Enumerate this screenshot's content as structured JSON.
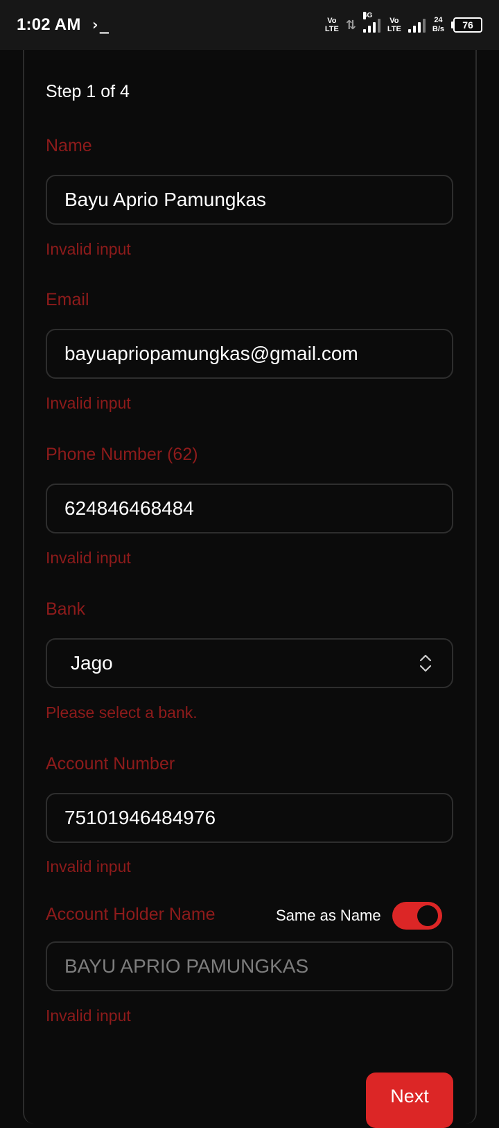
{
  "status_bar": {
    "time": "1:02 AM",
    "terminal_glyph": "›_",
    "volte1_top": "Vo",
    "volte1_bottom": "LTE",
    "network_type": "4G",
    "volte2_top": "Vo",
    "volte2_bottom": "LTE",
    "speed_value": "24",
    "speed_unit": "B/s",
    "battery_level": "76"
  },
  "form": {
    "step_text": "Step 1 of 4",
    "name": {
      "label": "Name",
      "value": "Bayu Aprio Pamungkas",
      "error": "Invalid input"
    },
    "email": {
      "label": "Email",
      "value": "bayuapriopamungkas@gmail.com",
      "error": "Invalid input"
    },
    "phone": {
      "label": "Phone Number (62)",
      "value": "624846468484",
      "error": "Invalid input"
    },
    "bank": {
      "label": "Bank",
      "selected": "Jago",
      "error": "Please select a bank."
    },
    "account_number": {
      "label": "Account Number",
      "value": "75101946484976",
      "error": "Invalid input"
    },
    "account_holder": {
      "label": "Account Holder Name",
      "same_as_label": "Same as Name",
      "toggle_on": true,
      "value": "BAYU APRIO PAMUNGKAS",
      "error": "Invalid input"
    },
    "next_label": "Next"
  },
  "colors": {
    "accent": "#dc2626",
    "error_text": "#8e1b1b",
    "background": "#0b0b0b",
    "status_bar": "#171717"
  }
}
